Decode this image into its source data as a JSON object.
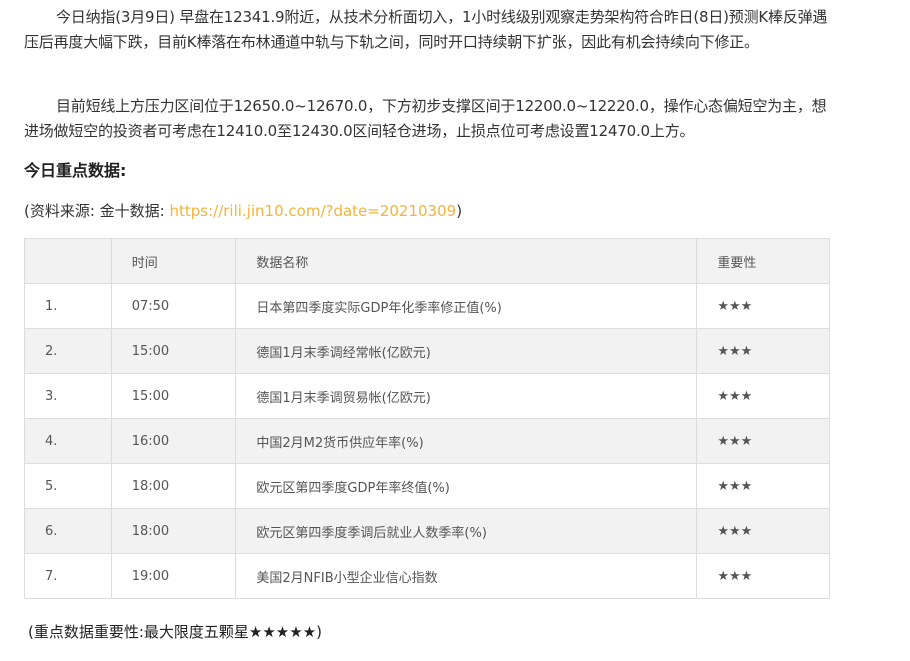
{
  "paragraphs": [
    "今日纳指(3月9日) 早盘在12341.9附近，从技术分析面切入，1小时线级别观察走势架构符合昨日(8日)预测K棒反弹遇压后再度大幅下跌，目前K棒落在布林通道中轨与下轨之间，同时开口持续朝下扩张，因此有机会持续向下修正。",
    "目前短线上方压力区间位于12650.0~12670.0，下方初步支撑区间于12200.0~12220.0，操作心态偏短空为主，想进场做短空的投资者可考虑在12410.0至12430.0区间轻仓进场，止损点位可考虑设置12470.0上方。"
  ],
  "heading": "今日重点数据:",
  "source": {
    "prefix": "(资料来源: 金十数据: ",
    "link": "https://rili.jin10.com/?date=20210309",
    "suffix": ")"
  },
  "table": {
    "headers": [
      "",
      "时间",
      "数据名称",
      "重要性"
    ],
    "rows": [
      {
        "no": "1.",
        "time": "07:50",
        "name": "日本第四季度实际GDP年化季率修正值(%)",
        "importance": "★★★"
      },
      {
        "no": "2.",
        "time": "15:00",
        "name": "德国1月末季调经常帐(亿欧元)",
        "importance": "★★★"
      },
      {
        "no": "3.",
        "time": "15:00",
        "name": "德国1月末季调贸易帐(亿欧元)",
        "importance": "★★★"
      },
      {
        "no": "4.",
        "time": "16:00",
        "name": "中国2月M2货币供应年率(%)",
        "importance": "★★★"
      },
      {
        "no": "5.",
        "time": "18:00",
        "name": "欧元区第四季度GDP年率终值(%)",
        "importance": "★★★"
      },
      {
        "no": "6.",
        "time": "18:00",
        "name": "欧元区第四季度季调后就业人数季率(%)",
        "importance": "★★★"
      },
      {
        "no": "7.",
        "time": "19:00",
        "name": "美国2月NFIB小型企业信心指数",
        "importance": "★★★"
      }
    ]
  },
  "note": "(重点数据重要性:最大限度五颗星★★★★★)"
}
